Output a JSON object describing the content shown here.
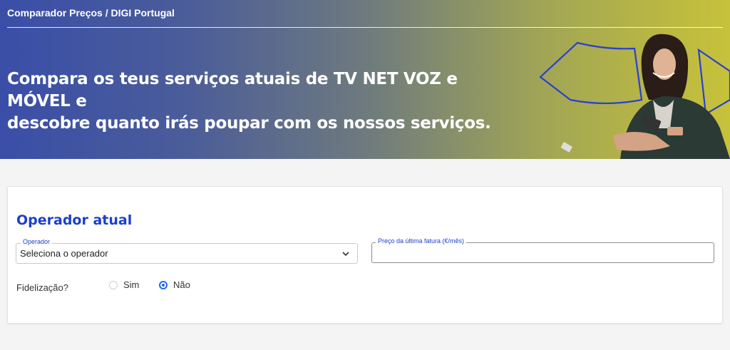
{
  "header": {
    "brand": "Comparador Preços / DIGI Portugal",
    "headline_line1": "Compara os teus serviços atuais de TV NET VOZ e MÓVEL e",
    "headline_line2": "descobre quanto irás poupar com os nossos serviços."
  },
  "form": {
    "title": "Operador atual",
    "operator": {
      "legend": "Operador",
      "value": "Seleciona o operador"
    },
    "price": {
      "legend": "Preço da última fatura (€/mês)",
      "value": ""
    },
    "fidelizacao": {
      "label": "Fidelização?",
      "options": [
        {
          "label": "Sim",
          "checked": false
        },
        {
          "label": "Não",
          "checked": true
        }
      ]
    }
  },
  "colors": {
    "accent": "#1d3fc9",
    "radio": "#1e6be8",
    "gradient_start": "#3a4ea8",
    "gradient_end": "#c7c23a"
  },
  "icons": {
    "select": "chevron-down-icon"
  }
}
